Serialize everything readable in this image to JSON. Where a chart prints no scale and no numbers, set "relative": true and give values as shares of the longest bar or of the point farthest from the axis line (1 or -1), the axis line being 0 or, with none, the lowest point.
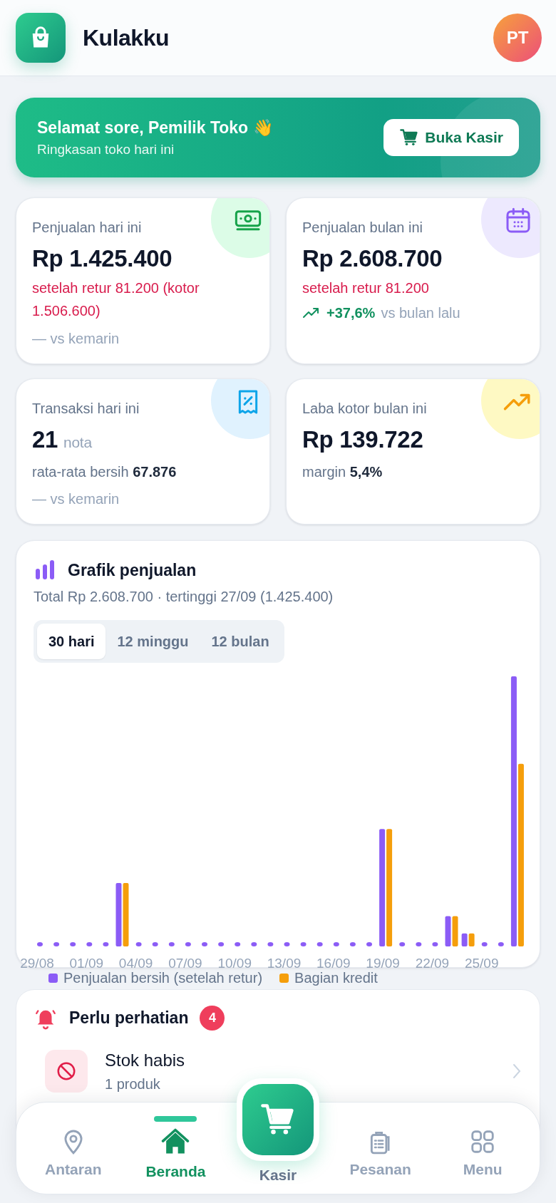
{
  "app": {
    "title": "Kulakku",
    "avatar": "PT"
  },
  "banner": {
    "greeting": "Selamat sore, Pemilik Toko 👋",
    "subtitle": "Ringkasan toko hari ini",
    "button": "Buka Kasir"
  },
  "stats": [
    {
      "kind": "money",
      "color": "#dcfce7",
      "title": "Penjualan hari ini",
      "value": "Rp 1.425.400",
      "lines": [
        {
          "kind": "note",
          "text": "setelah retur 81.200 (kotor 1.506.600)"
        },
        {
          "kind": "compare",
          "text": "— vs kemarin"
        }
      ]
    },
    {
      "kind": "calendar",
      "color": "#ede9fe",
      "title": "Penjualan bulan ini",
      "value": "Rp 2.608.700",
      "lines": [
        {
          "kind": "note",
          "text": "setelah retur 81.200"
        },
        {
          "kind": "trend",
          "change": "+37,6%",
          "text": "vs bulan lalu"
        }
      ]
    },
    {
      "kind": "receipt",
      "color": "#e0f2fe",
      "title": "Transaksi hari ini",
      "value": "21",
      "unit": "nota",
      "lines": [
        {
          "kind": "detail",
          "text": "rata-rata bersih **67.876**"
        },
        {
          "kind": "compare",
          "text": "— vs kemarin"
        }
      ]
    },
    {
      "kind": "trend",
      "color": "#fef9c3",
      "title": "Laba kotor bulan ini",
      "value": "Rp 139.722",
      "lines": [
        {
          "kind": "detail",
          "text": "margin **5,4%**"
        }
      ]
    }
  ],
  "sales_chart": {
    "title": "Grafik penjualan",
    "subtitle": "Total Rp 2.608.700 · tertinggi 27/09 (1.425.400)",
    "tabs": [
      {
        "label": "30 hari",
        "selected": true
      },
      {
        "label": "12 minggu",
        "selected": false
      },
      {
        "label": "12 bulan",
        "selected": false
      }
    ],
    "chart_data": {
      "type": "bar",
      "categories": [
        "29/08",
        null,
        null,
        "01/09",
        null,
        null,
        "04/09",
        null,
        null,
        "07/09",
        null,
        null,
        "10/09",
        null,
        null,
        "13/09",
        null,
        null,
        "16/09",
        null,
        null,
        "19/09",
        null,
        null,
        "22/09",
        null,
        null,
        "25/09",
        null,
        null
      ],
      "relative": true,
      "series": [
        {
          "name": "Penjualan bersih (setelah retur)",
          "color": "#8b5cf6",
          "values": [
            0,
            0,
            0,
            0,
            0,
            0.235,
            0,
            0,
            0,
            0,
            0,
            0,
            0,
            0,
            0,
            0,
            0,
            0,
            0,
            0,
            0,
            0.435,
            0,
            0,
            0,
            0.112,
            0.048,
            0,
            0,
            1
          ]
        },
        {
          "name": "Bagian kredit",
          "color": "#f59e0b",
          "values": [
            0,
            0,
            0,
            0,
            0,
            0.235,
            0,
            0,
            0,
            0,
            0,
            0,
            0,
            0,
            0,
            0,
            0,
            0,
            0,
            0,
            0,
            0.435,
            0,
            0,
            0,
            0.112,
            0.048,
            0,
            0,
            0.676
          ]
        }
      ]
    }
  },
  "attention": {
    "title": "Perlu perhatian",
    "count": "4",
    "items": [
      {
        "title": "Stok habis",
        "detail": "1 produk"
      }
    ]
  },
  "bottom_nav": [
    {
      "kind": "pin",
      "label": "Antaran",
      "selected": false
    },
    {
      "kind": "home",
      "label": "Beranda",
      "selected": true
    },
    {
      "kind": "cart",
      "label": "Kasir",
      "selected": false
    },
    {
      "kind": "clipboard",
      "label": "Pesanan",
      "selected": false
    },
    {
      "kind": "grid",
      "label": "Menu",
      "selected": false
    }
  ]
}
